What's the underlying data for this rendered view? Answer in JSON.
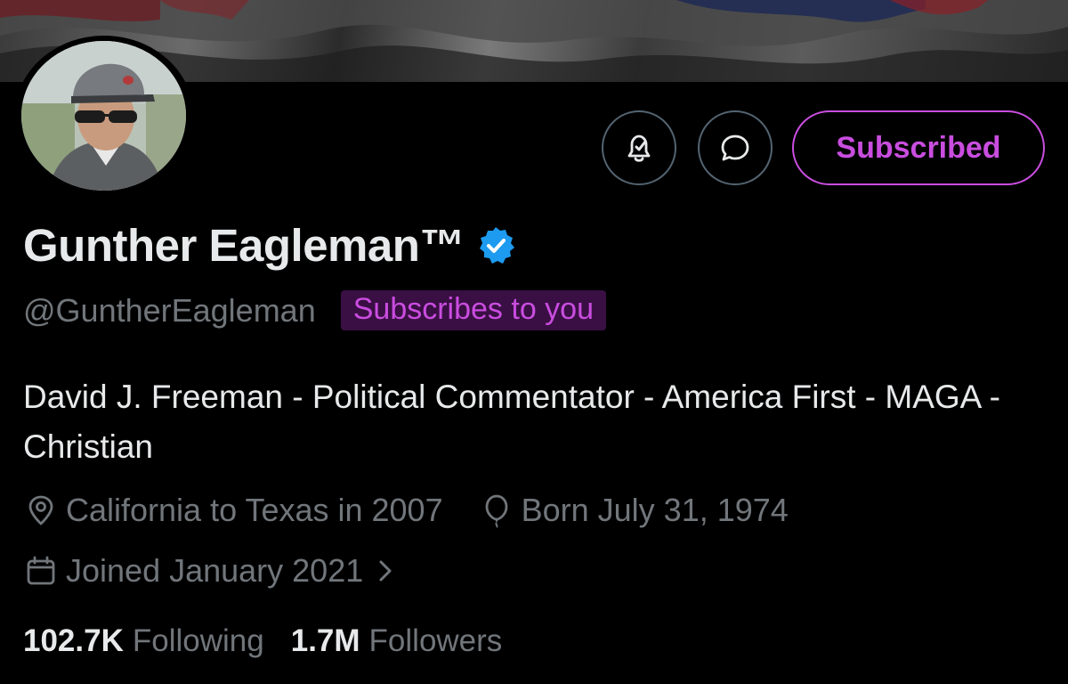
{
  "profile": {
    "display_name": "Gunther Eagleman™",
    "handle": "@GuntherEagleman",
    "subscribes_badge": "Subscribes to you",
    "bio": "David J. Freeman - Political Commentator - America First - MAGA - Christian",
    "location": "California to Texas in 2007",
    "birthday": "Born July 31, 1974",
    "joined": "Joined January 2021",
    "following_count": "102.7K",
    "following_label": "Following",
    "followers_count": "1.7M",
    "followers_label": "Followers"
  },
  "actions": {
    "subscribed_label": "Subscribed",
    "notify_icon": "bell-check-icon",
    "message_icon": "message-bubble-icon"
  },
  "colors": {
    "background": "#000000",
    "text_primary": "#e7e9ea",
    "text_secondary": "#71767b",
    "accent_purple": "#c94ddf",
    "badge_background": "#3a0f44",
    "verified_blue": "#1d9bf0",
    "border": "#536471"
  }
}
